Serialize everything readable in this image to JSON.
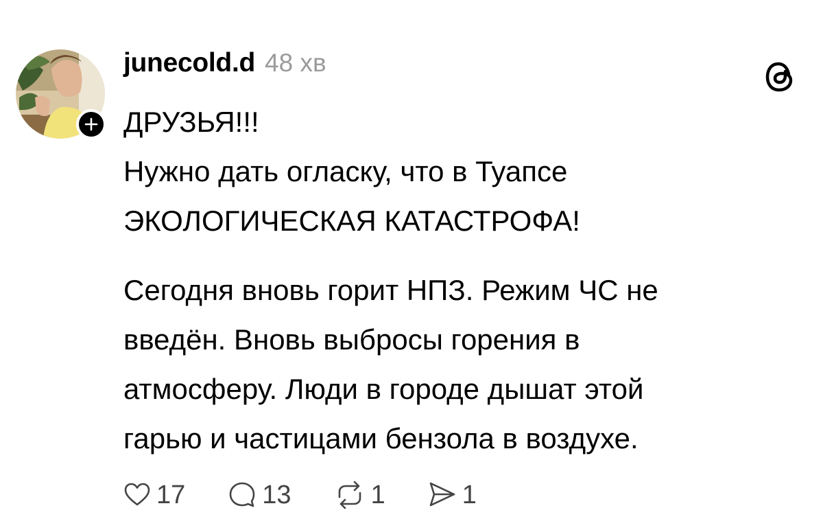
{
  "post": {
    "author": "junecold.d",
    "time": "48 хв",
    "paragraphs": [
      "ДРУЗЬЯ!!!\nНужно дать огласку, что в Туапсе\nЭКОЛОГИЧЕСКАЯ КАТАСТРОФА!",
      "Сегодня вновь горит НПЗ. Режим ЧС не\nвведён. Вновь выбросы горения в\nатмосферу. Люди в городе дышат этой\nгарью и частицами бензола в воздухе."
    ]
  },
  "actions": {
    "likes": "17",
    "comments": "13",
    "reposts": "1",
    "shares": "1"
  },
  "icons": {
    "avatar": "avatar-photo",
    "follow": "plus-icon",
    "app": "threads-logo-icon",
    "like": "heart-icon",
    "comment": "comment-bubble-icon",
    "repost": "repost-icon",
    "share": "send-icon"
  }
}
